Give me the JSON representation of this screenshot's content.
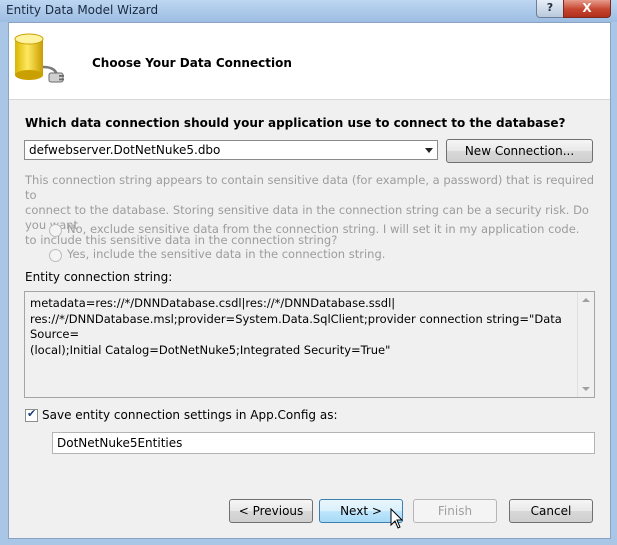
{
  "window": {
    "title": "Entity Data Model Wizard",
    "help_label": "?",
    "close_label": "X"
  },
  "header": {
    "heading": "Choose Your Data Connection",
    "icon": "database-connection-icon"
  },
  "connection": {
    "question": "Which data connection should your application use to connect to the database?",
    "selected": "defwebserver.DotNetNuke5.dbo",
    "new_connection_label": "New Connection..."
  },
  "sensitive": {
    "info_line1": "This connection string appears to contain sensitive data (for example, a password) that is required to",
    "info_line2": "connect to the database. Storing sensitive data in the connection string can be a security risk. Do you want",
    "info_line3": "to include this sensitive data in the connection string?",
    "option_exclude": "No, exclude sensitive data from the connection string. I will set it in my application code.",
    "option_include": "Yes, include the sensitive data in the connection string."
  },
  "entity": {
    "label": "Entity connection string:",
    "value": "metadata=res://*/DNNDatabase.csdl|res://*/DNNDatabase.ssdl|\nres://*/DNNDatabase.msl;provider=System.Data.SqlClient;provider connection string=\"Data Source=\n(local);Initial Catalog=DotNetNuke5;Integrated Security=True\""
  },
  "save": {
    "checked": true,
    "label": "Save entity connection settings in App.Config as:",
    "name_value": "DotNetNuke5Entities"
  },
  "buttons": {
    "previous": "< Previous",
    "next": "Next >",
    "finish": "Finish",
    "cancel": "Cancel"
  }
}
